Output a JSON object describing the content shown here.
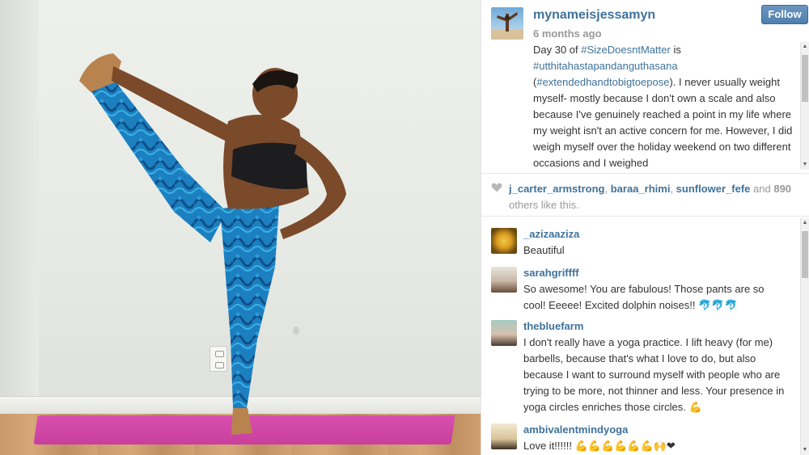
{
  "photo": {
    "alt_colors": {
      "wall": "#e6e9e4",
      "mat": "#d94fae",
      "floor": "#c89a6c",
      "leggings": "#1e88c8"
    }
  },
  "post": {
    "username": "mynameisjessamyn",
    "time_ago": "6 months ago",
    "follow_label": "Follow",
    "caption": {
      "p1": "Day 30 of ",
      "tag1": "#SizeDoesntMatter",
      "p2": " is ",
      "tag2": "#utthitahastapandanguthasana",
      "p3": " (",
      "tag3": "#extendedhandtobigtoepose",
      "p4": "). I never usually weight myself- mostly because I don't own a scale and also because I've genuinely reached a point in my life where my weight isn't an active concern for me. However, I did weigh myself over the holiday weekend on two different occasions and I weighed"
    }
  },
  "likes": {
    "heart_icon": "heart-icon",
    "likers": [
      "j_carter_armstrong",
      "baraa_rhimi",
      "sunflower_fefe"
    ],
    "sep1": ", ",
    "sep2": ", ",
    "and_text": " and ",
    "count": "890",
    "others_text": " others like this."
  },
  "comments": [
    {
      "user": "_azizaaziza",
      "text": "Beautiful"
    },
    {
      "user": "sarahgriffff",
      "text": "So awesome! You are fabulous! Those pants are so cool! Eeeee! Excited dolphin noises!! 🐬🐬🐬"
    },
    {
      "user": "thebluefarm",
      "text": "I don't really have a yoga practice. I lift heavy (for me) barbells, because that's what I love to do, but also because I want to surround myself with people who are trying to be more, not thinner and less. Your presence in yoga circles enriches those circles. 💪"
    },
    {
      "user": "ambivalentmindyoga",
      "text": "Love it!!!!!! 💪💪💪💪💪💪🙌❤"
    }
  ],
  "colors": {
    "link": "#3f729b",
    "follow_bg": "#5a88b6",
    "muted": "#999999"
  }
}
